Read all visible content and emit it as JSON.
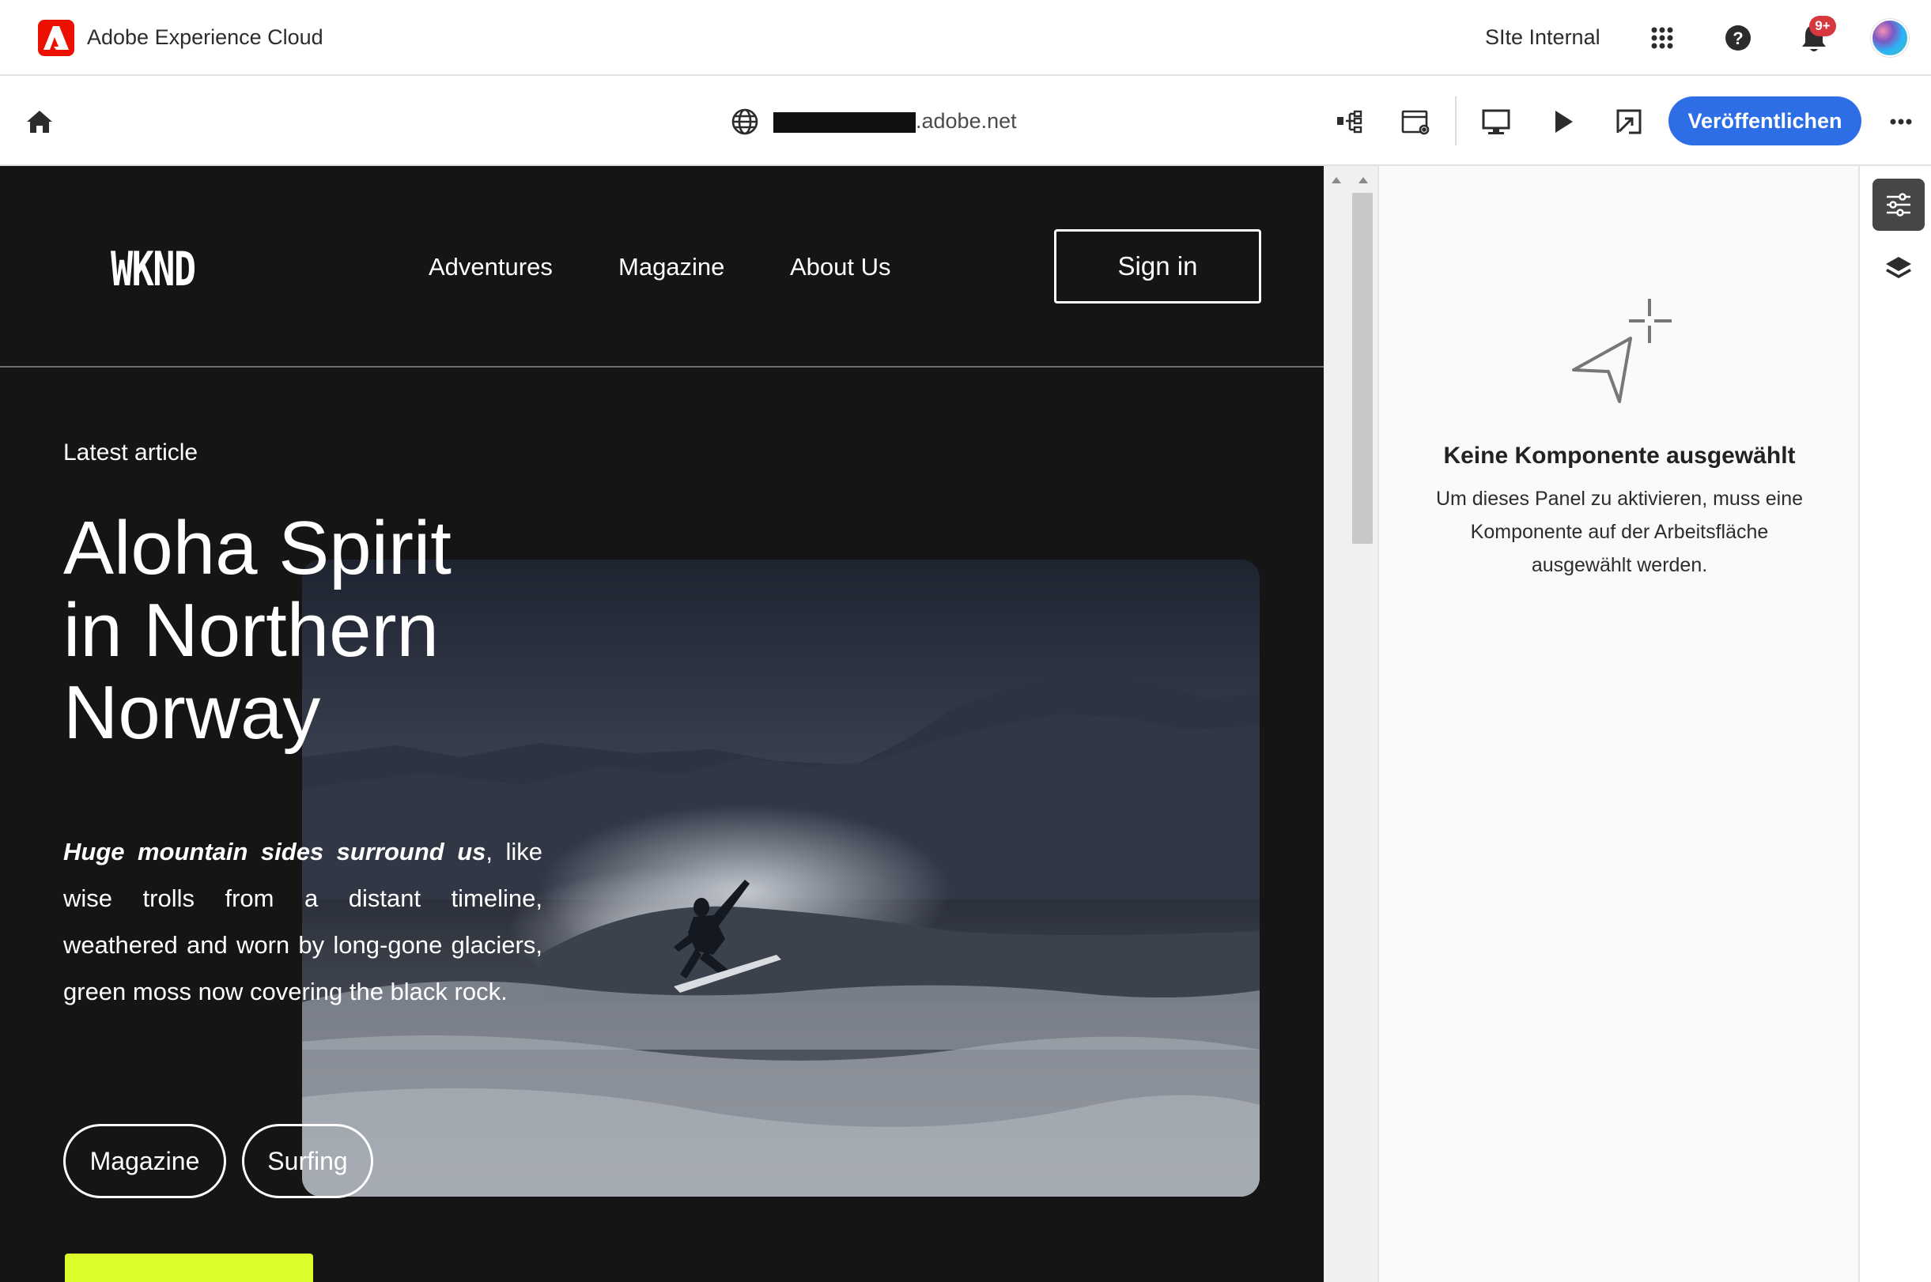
{
  "shell": {
    "app_title": "Adobe Experience Cloud",
    "org_name": "SIte Internal",
    "notification_badge": "9+",
    "icons": [
      "adobe-logo-icon",
      "apps-grid-icon",
      "help-icon",
      "bell-icon",
      "avatar"
    ]
  },
  "toolbar": {
    "url_suffix": ".adobe.net",
    "publish_label": "Veröffentlichen",
    "publish_color": "#2d6ee6",
    "icons": [
      "home-icon",
      "globe-icon",
      "content-tree-icon",
      "page-properties-icon",
      "desktop-preview-icon",
      "play-icon",
      "open-external-icon",
      "more-icon"
    ]
  },
  "site": {
    "logo": "WKND",
    "nav": [
      "Adventures",
      "Magazine",
      "About Us"
    ],
    "signin_label": "Sign in",
    "latest_label": "Latest article",
    "title_line1": "Aloha Spirit",
    "title_line2": "in Northern",
    "title_line3": "Norway",
    "text_lead": "Huge mountain sides surround us",
    "text_rest": ", like wise trolls from a distant timeline, weathered and worn by long-gone glaciers, green moss now covering the black rock.",
    "tags": [
      "Magazine",
      "Surfing"
    ],
    "cta_color": "#dbff2a",
    "background_color": "#151515"
  },
  "panel": {
    "empty_title": "Keine Komponente ausgewählt",
    "empty_desc": "Um dieses Panel zu aktivieren, muss eine Komponente auf der Arbeitsfläche ausgewählt werden."
  },
  "rail": {
    "icons": [
      "properties-sliders-icon",
      "layers-icon"
    ]
  }
}
